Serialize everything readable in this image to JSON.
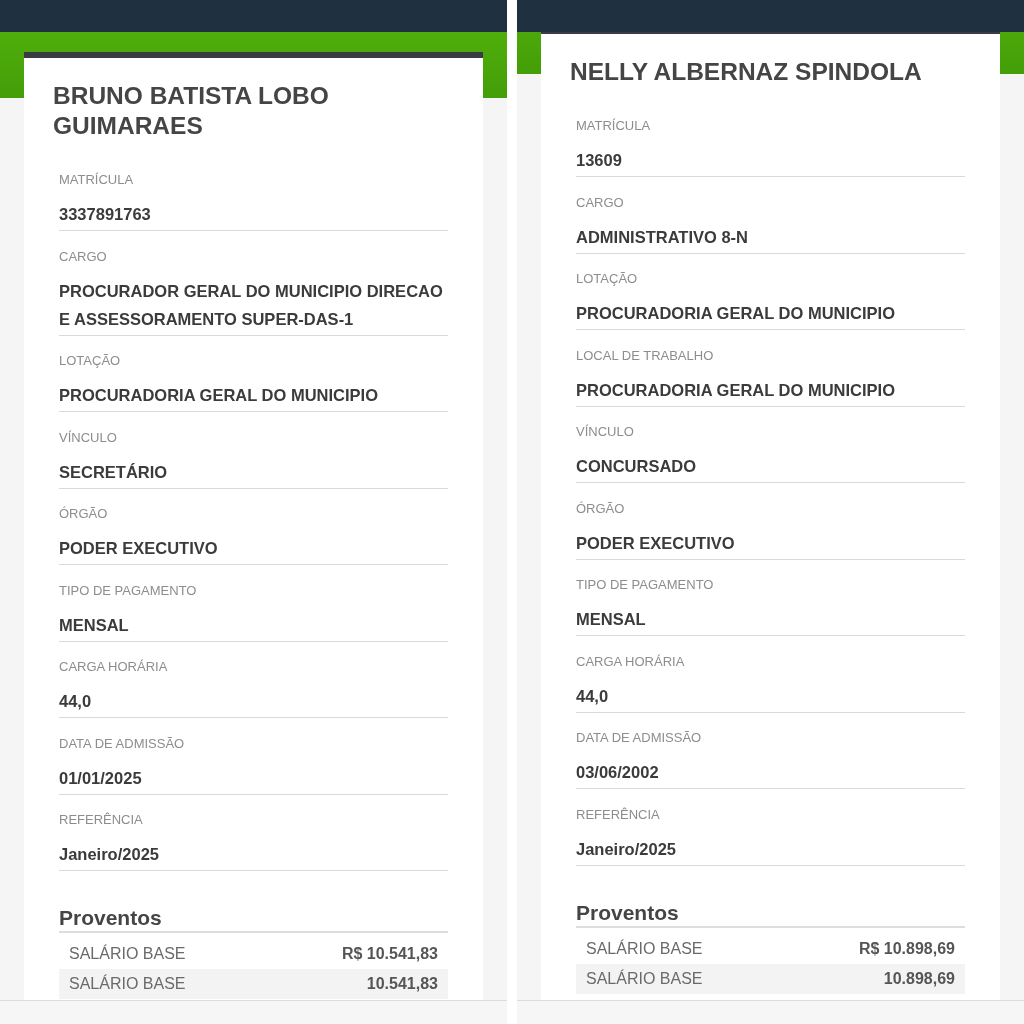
{
  "screens": [
    {
      "employee_name": "BRUNO BATISTA LOBO GUIMARAES",
      "fields": [
        {
          "label": "MATRÍCULA",
          "value": "3337891763"
        },
        {
          "label": "CARGO",
          "value": "PROCURADOR GERAL DO MUNICIPIO DIRECAO E ASSESSORAMENTO SUPER-DAS-1"
        },
        {
          "label": "LOTAÇÃO",
          "value": "PROCURADORIA GERAL DO MUNICIPIO"
        },
        {
          "label": "VÍNCULO",
          "value": "SECRETÁRIO"
        },
        {
          "label": "ÓRGÃO",
          "value": "PODER EXECUTIVO"
        },
        {
          "label": "TIPO DE PAGAMENTO",
          "value": "MENSAL"
        },
        {
          "label": "CARGA HORÁRIA",
          "value": "44,0"
        },
        {
          "label": "DATA DE ADMISSÃO",
          "value": "01/01/2025"
        },
        {
          "label": "REFERÊNCIA",
          "value": "Janeiro/2025"
        }
      ],
      "earnings": {
        "title": "Proventos",
        "rows": [
          {
            "label": "SALÁRIO BASE",
            "value": "R$ 10.541,83"
          },
          {
            "label": "SALÁRIO BASE",
            "value": "10.541,83"
          }
        ]
      }
    },
    {
      "employee_name": "NELLY ALBERNAZ SPINDOLA",
      "fields": [
        {
          "label": "MATRÍCULA",
          "value": "13609"
        },
        {
          "label": "CARGO",
          "value": "ADMINISTRATIVO 8-N"
        },
        {
          "label": "LOTAÇÃO",
          "value": "PROCURADORIA GERAL DO MUNICIPIO"
        },
        {
          "label": "LOCAL DE TRABALHO",
          "value": "PROCURADORIA GERAL DO MUNICIPIO"
        },
        {
          "label": "VÍNCULO",
          "value": "CONCURSADO"
        },
        {
          "label": "ÓRGÃO",
          "value": "PODER EXECUTIVO"
        },
        {
          "label": "TIPO DE PAGAMENTO",
          "value": "MENSAL"
        },
        {
          "label": "CARGA HORÁRIA",
          "value": "44,0"
        },
        {
          "label": "DATA DE ADMISSÃO",
          "value": "03/06/2002"
        },
        {
          "label": "REFERÊNCIA",
          "value": "Janeiro/2025"
        }
      ],
      "earnings": {
        "title": "Proventos",
        "rows": [
          {
            "label": "SALÁRIO BASE",
            "value": "R$ 10.898,69"
          },
          {
            "label": "SALÁRIO BASE",
            "value": "10.898,69"
          }
        ]
      }
    }
  ]
}
